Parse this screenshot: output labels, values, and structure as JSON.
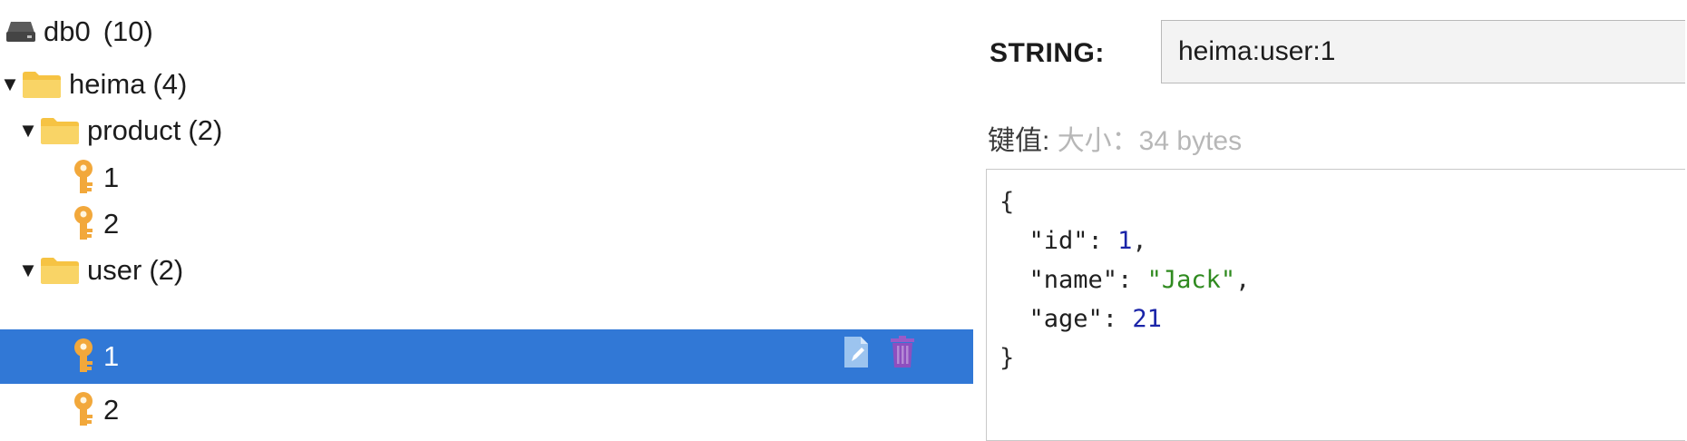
{
  "tree": {
    "db": {
      "name": "db0",
      "count": "(10)"
    },
    "folders": [
      {
        "name": "heima",
        "count": "(4)"
      },
      {
        "name": "product",
        "count": "(2)",
        "keys": [
          "1",
          "2"
        ]
      },
      {
        "name": "user",
        "count": "(2)",
        "keys": [
          "1",
          "2"
        ]
      }
    ],
    "selected_key": "user:1"
  },
  "detail": {
    "type_label": "STRING:",
    "key_value": "heima:user:1",
    "meta_label": "键值:",
    "meta_size": "大小：34 bytes",
    "value_lines": {
      "open": "{",
      "id_key": "\"id\"",
      "id_val": "1",
      "name_key": "\"name\"",
      "name_val": "\"Jack\"",
      "age_key": "\"age\"",
      "age_val": "21",
      "close": "}"
    }
  },
  "colors": {
    "selection": "#3178d6",
    "folder": "#f6c343",
    "key": "#f2a83b",
    "json_number": "#1a24a8",
    "json_string": "#2f8a1f"
  },
  "icons": {
    "db": "database-icon",
    "folder": "folder-icon",
    "key": "key-icon",
    "edit": "edit-document-icon",
    "delete": "trash-icon"
  }
}
